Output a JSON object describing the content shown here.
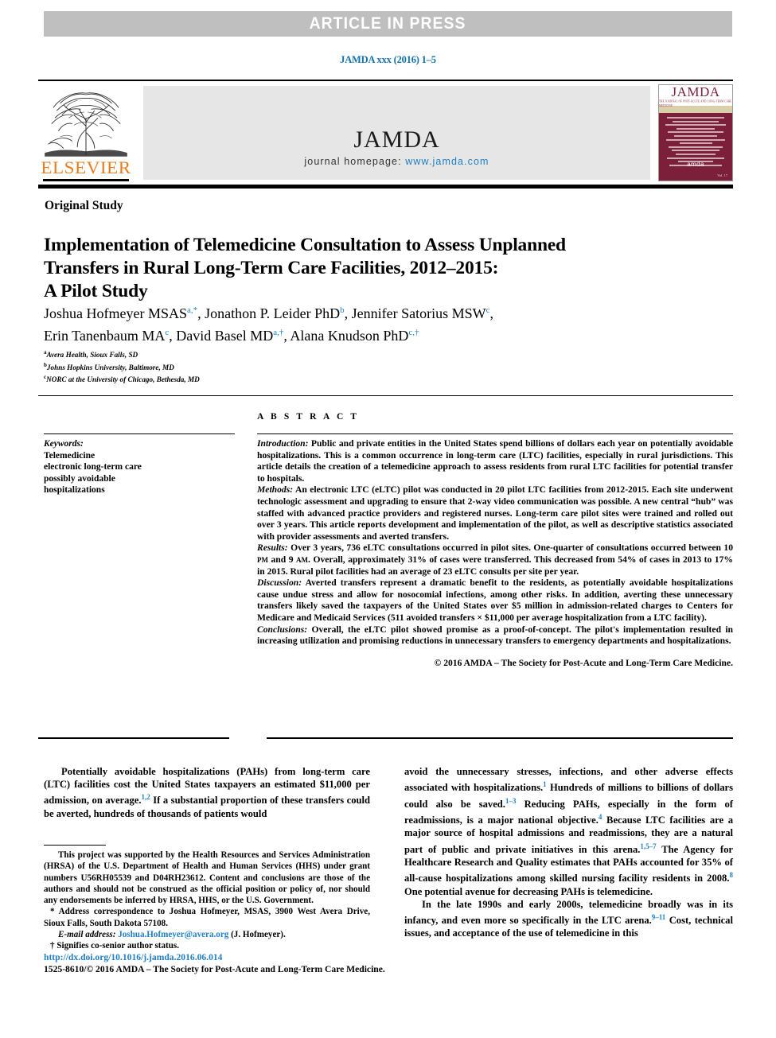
{
  "banner": {
    "text": "ARTICLE IN PRESS"
  },
  "citation": {
    "text": "JAMDA xxx (2016) 1–5"
  },
  "journal_header": {
    "publisher_name": "ELSEVIER",
    "journal_title": "JAMDA",
    "homepage_label": "journal homepage:",
    "homepage_url": "www.jamda.com",
    "cover": {
      "title": "JAMDA",
      "subtitle": "THE JOURNAL OF POST-ACUTE AND LONG-TERM CARE MEDICINE",
      "logo": "amda",
      "issue": "Vol. 17"
    }
  },
  "article": {
    "section_label": "Original Study",
    "title_lines": [
      "Implementation of Telemedicine Consultation to Assess Unplanned",
      "Transfers in Rural Long-Term Care Facilities, 2012–2015:",
      "A Pilot Study"
    ],
    "author_lines": [
      "Joshua Hofmeyer MSAS",
      "Jonathon P. Leider PhD",
      "Jennifer Satorius MSW",
      "Erin Tanenbaum MA",
      "David Basel MD",
      "Alana Knudson PhD"
    ],
    "affiliations": [
      {
        "marker": "a",
        "text": "Avera Health, Sioux Falls, SD"
      },
      {
        "marker": "b",
        "text": "Johns Hopkins University, Baltimore, MD"
      },
      {
        "marker": "c",
        "text": "NORC at the University of Chicago, Bethesda, MD"
      }
    ]
  },
  "keywords": {
    "heading": "Keywords:",
    "items": [
      "Telemedicine",
      "electronic long-term care",
      "possibly avoidable",
      "hospitalizations"
    ]
  },
  "abstract": {
    "heading": "A B S T R A C T",
    "introduction_label": "Introduction:",
    "introduction": " Public and private entities in the United States spend billions of dollars each year on potentially avoidable hospitalizations. This is a common occurrence in long-term care (LTC) facilities, especially in rural jurisdictions. This article details the creation of a telemedicine approach to assess residents from rural LTC facilities for potential transfer to hospitals.",
    "methods_label": "Methods:",
    "methods": " An electronic LTC (eLTC) pilot was conducted in 20 pilot LTC facilities from 2012-2015. Each site underwent technologic assessment and upgrading to ensure that 2-way video communication was possible. A new central “hub” was staffed with advanced practice providers and registered nurses. Long-term care pilot sites were trained and rolled out over 3 years. This article reports development and implementation of the pilot, as well as descriptive statistics associated with provider assessments and averted transfers.",
    "results_label": "Results:",
    "results_part1": " Over 3 years, 736 eLTC consultations occurred in pilot sites. One-quarter of consultations occurred between 10 ",
    "results_pm": "PM",
    "results_part2": " and 9 ",
    "results_am": "AM",
    "results_part3": ". Overall, approximately 31% of cases were transferred. This decreased from 54% of cases in 2013 to 17% in 2015. Rural pilot facilities had an average of 23 eLTC consults per site per year.",
    "discussion_label": "Discussion:",
    "discussion": " Averted transfers represent a dramatic benefit to the residents, as potentially avoidable hospitalizations cause undue stress and allow for nosocomial infections, among other risks. In addition, averting these unnecessary transfers likely saved the taxpayers of the United States over $5 million in admission-related charges to Centers for Medicare and Medicaid Services (511 avoided transfers × $11,000 per average hospitalization from a LTC facility).",
    "conclusions_label": "Conclusions:",
    "conclusions": " Overall, the eLTC pilot showed promise as a proof-of-concept. The pilot's implementation resulted in increasing utilization and promising reductions in unnecessary transfers to emergency departments and hospitalizations.",
    "copyright": "© 2016 AMDA – The Society for Post-Acute and Long-Term Care Medicine."
  },
  "body": {
    "left_para1_a": "Potentially avoidable hospitalizations (PAHs) from long-term care (LTC) facilities cost the United States taxpayers an estimated $11,000 per admission, on average.",
    "left_para1_ref": "1,2",
    "left_para1_b": " If a substantial proportion of these transfers could be averted, hundreds of thousands of patients would",
    "right_para1_a": "avoid the unnecessary stresses, infections, and other adverse effects associated with hospitalizations.",
    "right_para1_ref1": "1",
    "right_para1_b": " Hundreds of millions to billions of dollars could also be saved.",
    "right_para1_ref2": "1–3",
    "right_para1_c": " Reducing PAHs, especially in the form of readmissions, is a major national objective.",
    "right_para1_ref3": "4",
    "right_para1_d": " Because LTC facilities are a major source of hospital admissions and readmissions, they are a natural part of public and private initiatives in this arena.",
    "right_para1_ref4": "1,5–7",
    "right_para1_e": " The Agency for Healthcare Research and Quality estimates that PAHs accounted for 35% of all-cause hospitalizations among skilled nursing facility residents in 2008.",
    "right_para1_ref5": "8",
    "right_para1_f": " One potential avenue for decreasing PAHs is telemedicine.",
    "right_para2_a": "In the late 1990s and early 2000s, telemedicine broadly was in its infancy, and even more so specifically in the LTC arena.",
    "right_para2_ref": "9–11",
    "right_para2_b": " Cost, technical issues, and acceptance of the use of telemedicine in this"
  },
  "footnotes": {
    "funding": "This project was supported by the Health Resources and Services Administration (HRSA) of the U.S. Department of Health and Human Services (HHS) under grant numbers U56RH05539 and D04RH23612. Content and conclusions are those of the authors and should not be construed as the official position or policy of, nor should any endorsements be inferred by HRSA, HHS, or the U.S. Government.",
    "correspondence": "* Address correspondence to Joshua Hofmeyer, MSAS, 3900 West Avera Drive, Sioux Falls, South Dakota 57108.",
    "email_label": "E-mail address:",
    "email": "Joshua.Hofmeyer@avera.org",
    "email_suffix": " (J. Hofmeyer).",
    "cosenior": "† Signifies co-senior author status."
  },
  "doi_block": {
    "doi": "http://dx.doi.org/10.1016/j.jamda.2016.06.014",
    "issn": "1525-8610/© 2016 AMDA – The Society for Post-Acute and Long-Term Care Medicine."
  },
  "colors": {
    "link_blue": "#1f7fc4",
    "banner_gray": "#bfbfbf",
    "panel_gray": "#e6e6e6",
    "elsevier_orange": "#e87d1e",
    "cover_maroon": "#7b1f3a"
  }
}
